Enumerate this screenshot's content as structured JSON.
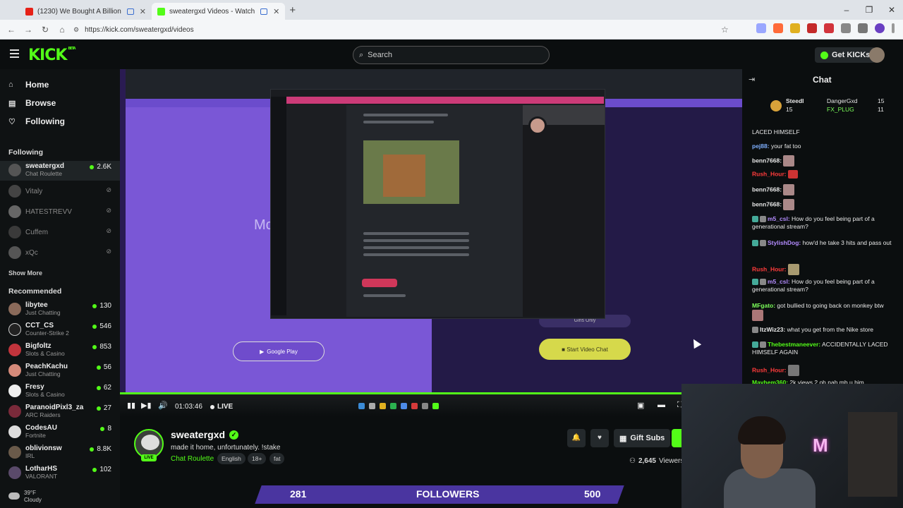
{
  "browser": {
    "tabs": [
      {
        "title": "(1230) We Bought A Billion",
        "active": false
      },
      {
        "title": "sweatergxd Videos - Watch",
        "active": true
      }
    ],
    "new_tab": "+",
    "url": "https://kick.com/sweatergxd/videos",
    "window_controls": [
      "–",
      "❐",
      "✕"
    ]
  },
  "header": {
    "logo": "KICK",
    "logo_tag": "BETA",
    "search_placeholder": "Search",
    "get_kicks": "Get KICKs"
  },
  "sidebar": {
    "nav": [
      {
        "label": "Home",
        "icon": "home-icon"
      },
      {
        "label": "Browse",
        "icon": "browse-icon"
      },
      {
        "label": "Following",
        "icon": "heart-icon"
      }
    ],
    "following_title": "Following",
    "following": [
      {
        "name": "sweatergxd",
        "sub": "Chat Roulette",
        "viewers": "2.6K",
        "live": true
      },
      {
        "name": "Vitaly",
        "live": false
      },
      {
        "name": "HATESTREVV",
        "live": false
      },
      {
        "name": "Cuffem",
        "live": false
      },
      {
        "name": "xQc",
        "live": false
      }
    ],
    "show_more": "Show More",
    "recommended_title": "Recommended",
    "recommended": [
      {
        "name": "libytee",
        "sub": "Just Chatting",
        "viewers": "130"
      },
      {
        "name": "CCT_CS",
        "sub": "Counter-Strike 2",
        "viewers": "546"
      },
      {
        "name": "Bigfoltz",
        "sub": "Slots & Casino",
        "viewers": "853"
      },
      {
        "name": "PeachKachu",
        "sub": "Just Chatting",
        "viewers": "56"
      },
      {
        "name": "Fresy",
        "sub": "Slots & Casino",
        "viewers": "62"
      },
      {
        "name": "ParanoidPixl3_za",
        "sub": "ARC Raiders",
        "viewers": "27"
      },
      {
        "name": "CodesAU",
        "sub": "Fortnite",
        "viewers": "8"
      },
      {
        "name": "oblivionsw",
        "sub": "IRL",
        "viewers": "8.8K"
      },
      {
        "name": "LotharHS",
        "sub": "VALORANT",
        "viewers": "102"
      }
    ],
    "weather_temp": "39°F",
    "weather_cond": "Cloudy"
  },
  "player": {
    "time": "01:03:46",
    "live": "LIVE",
    "app_button": "Google Play",
    "video_chat_button": "Start Video Chat",
    "gender_pill": "Girls Only",
    "overlay_text": "Mc"
  },
  "channel": {
    "username": "sweatergxd",
    "title": "made it home, unfortunately. !stake",
    "category": "Chat Roulette",
    "tags": [
      "English",
      "18+",
      "fat"
    ],
    "gift_subs": "Gift Subs",
    "viewers": "2,645",
    "viewers_label": "Viewers",
    "live_badge": "LIVE"
  },
  "overlay": {
    "count": "281",
    "label": "FOLLOWERS",
    "goal": "500"
  },
  "chat": {
    "title": "Chat",
    "pinned": [
      {
        "user": "Steedl",
        "count": "15"
      },
      {
        "user": "DangerGxd",
        "count": "15"
      },
      {
        "user": "FX_PLUG",
        "count": "11"
      }
    ],
    "messages": [
      {
        "user": "",
        "text": "LACED HIMSELF",
        "color": "#e8e8e8"
      },
      {
        "user": "pej88:",
        "text": "your fat too",
        "color": "#7fb0ff"
      },
      {
        "user": "benn7668:",
        "text": "",
        "color": "#e8e8e8"
      },
      {
        "user": "Rush_Hour:",
        "text": "",
        "color": "#ff3b3b"
      },
      {
        "user": "benn7668:",
        "text": "",
        "color": "#e8e8e8"
      },
      {
        "user": "benn7668:",
        "text": "",
        "color": "#e8e8e8"
      },
      {
        "user": "m5_csl:",
        "text": "How do you feel being part of a generational stream?",
        "color": "#b48cff"
      },
      {
        "user": "StylishDog:",
        "text": "how'd he take 3 hits and pass out",
        "color": "#b48cff"
      },
      {
        "user": "Rush_Hour:",
        "text": "",
        "color": "#ff3b3b"
      },
      {
        "user": "m5_csl:",
        "text": "How do you feel being part of a generational stream?",
        "color": "#b48cff"
      },
      {
        "user": "MFgato:",
        "text": "got bullied to going back on monkey btw",
        "color": "#7cff5a"
      },
      {
        "user": "ItzWiz23:",
        "text": "what you get from the Nike store",
        "color": "#e8e8e8"
      },
      {
        "user": "Thebestmaneever:",
        "text": "ACCIDENTALLY LACED HIMSELF AGAIN",
        "color": "#53fc18"
      },
      {
        "user": "Rush_Hour:",
        "text": "",
        "color": "#ff3b3b"
      },
      {
        "user": "Mayhem360:",
        "text": "2k views 2 oh nah mb u him",
        "color": "#53fc18"
      }
    ]
  },
  "webcam": {
    "neon_sign": "M"
  }
}
